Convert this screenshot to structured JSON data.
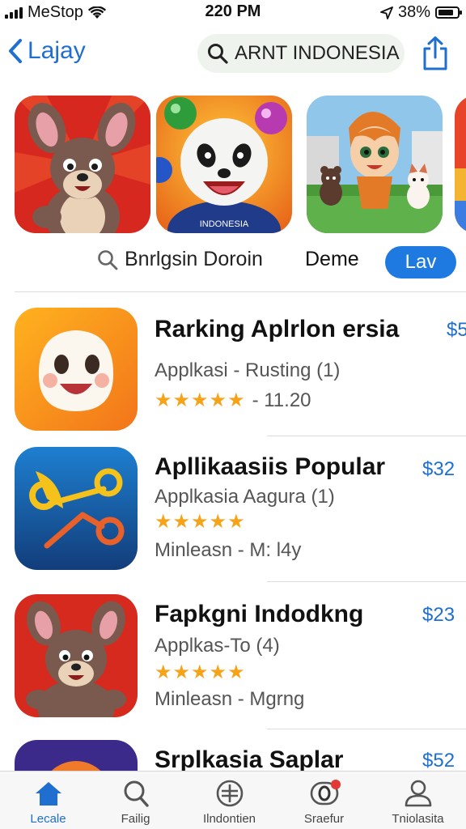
{
  "status_bar": {
    "carrier": "MeStop",
    "time": "220 PM",
    "battery": "38%",
    "icons": [
      "signal-icon",
      "wifi-icon",
      "location-icon",
      "battery-icon"
    ]
  },
  "nav": {
    "back_label": "Lajay",
    "search_text": "ARNT INDONESIA",
    "icons": [
      "chevron-left-icon",
      "search-icon",
      "share-icon"
    ]
  },
  "featured": {
    "cards": [
      {
        "name": "featured-card-kangaroo",
        "caption": ""
      },
      {
        "name": "featured-card-panda",
        "caption": "INDONESIA"
      },
      {
        "name": "featured-card-cartoon-characters",
        "caption": ""
      },
      {
        "name": "featured-card-partial",
        "caption": ""
      }
    ]
  },
  "filters": {
    "search_label": "Bnrlgsin Doroin",
    "option_label": "Deme",
    "button_label": "Lav"
  },
  "apps": [
    {
      "title": "Rarking Aplrlon ersia",
      "subtitle": "Applkasi - Rusting (1)",
      "stars": "★★★★★",
      "meta": "- 11.20",
      "price": "$5"
    },
    {
      "title": "Apllikaasiis Popular",
      "subtitle": "Applkasia Aagura (1)",
      "stars": "★★★★★",
      "meta": "Minleasn - M: l4y",
      "price": "$32"
    },
    {
      "title": "Fapkgni Indodkng",
      "subtitle": "Applkas-To (4)",
      "stars": "★★★★★",
      "meta": "Minleasn - Mgrng",
      "price": "$23"
    },
    {
      "title": "Srplkasia Saplar",
      "subtitle": "",
      "stars": "",
      "meta": "",
      "price": "$52"
    }
  ],
  "tabbar": {
    "tabs": [
      {
        "label": "Lecale",
        "icon": "home-icon",
        "active": true
      },
      {
        "label": "Failig",
        "icon": "search-icon",
        "active": false
      },
      {
        "label": "Ilndontien",
        "icon": "grid-icon",
        "active": false
      },
      {
        "label": "Sraefur",
        "icon": "updates-icon",
        "active": false
      },
      {
        "label": "Tniolasita",
        "icon": "profile-icon",
        "active": false
      }
    ]
  },
  "colors": {
    "accent": "#1e7ae0",
    "star": "#f5a41a",
    "badge": "#e53935"
  }
}
